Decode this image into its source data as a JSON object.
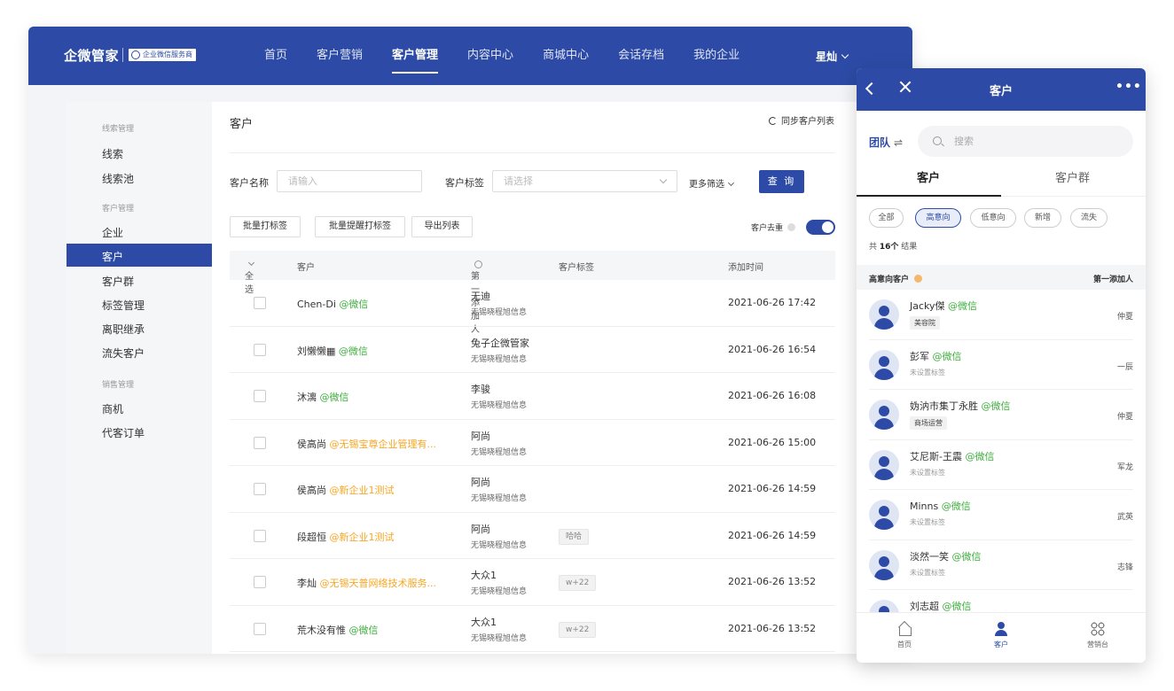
{
  "app": {
    "brand": "企微管家",
    "badge": "企业微信服务商"
  },
  "nav": [
    "首页",
    "客户营销",
    "客户管理",
    "内容中心",
    "商城中心",
    "会话存档",
    "我的企业"
  ],
  "nav_active": "客户管理",
  "user": {
    "name": "星灿"
  },
  "sidebar": {
    "groups": [
      {
        "title": "线索管理",
        "items": [
          "线索",
          "线索池"
        ]
      },
      {
        "title": "客户管理",
        "items": [
          "企业",
          "客户",
          "客户群",
          "标签管理",
          "离职继承",
          "流失客户"
        ]
      },
      {
        "title": "销售管理",
        "items": [
          "商机",
          "代客订单"
        ]
      }
    ],
    "active": "客户"
  },
  "main": {
    "title": "客户",
    "sync_label": "同步客户列表",
    "filters": {
      "name_label": "客户名称",
      "name_placeholder": "请输入",
      "tag_label": "客户标签",
      "tag_placeholder": "请选择",
      "more_label": "更多筛选",
      "query_label": "查 询"
    },
    "actions": [
      "批量打标签",
      "批量提醒打标签",
      "导出列表"
    ],
    "dedup_label": "客户去重",
    "dedup_on": true,
    "columns": {
      "select_all": "全选",
      "customer": "客户",
      "adder": "第一添加人",
      "tags": "客户标签",
      "time": "添加时间"
    },
    "rows": [
      {
        "name": "Chen-Di",
        "source": "@微信",
        "source_color": "#3fae3f",
        "adder": "无迪",
        "org": "无锡晓程旭信息",
        "tag": "",
        "time": "2021-06-26 17:42"
      },
      {
        "name": "刘懒懒▦",
        "source": "@微信",
        "source_color": "#3fae3f",
        "adder": "兔子企微管家",
        "org": "无锡晓程旭信息",
        "tag": "",
        "time": "2021-06-26 16:54"
      },
      {
        "name": "沐漓",
        "source": "@微信",
        "source_color": "#3fae3f",
        "adder": "李骏",
        "org": "无锡晓程旭信息",
        "tag": "",
        "time": "2021-06-26 16:08"
      },
      {
        "name": "侯高尚",
        "source": "@无锡宝尊企业管理有...",
        "source_color": "#f5a623",
        "adder": "阿尚",
        "org": "无锡晓程旭信息",
        "tag": "",
        "time": "2021-06-26 15:00"
      },
      {
        "name": "侯高尚",
        "source": "@新企业1测试",
        "source_color": "#f5a623",
        "adder": "阿尚",
        "org": "无锡晓程旭信息",
        "tag": "",
        "time": "2021-06-26 14:59"
      },
      {
        "name": "段超恒",
        "source": "@新企业1测试",
        "source_color": "#f5a623",
        "adder": "阿尚",
        "org": "无锡晓程旭信息",
        "tag": "哈哈",
        "time": "2021-06-26 14:59"
      },
      {
        "name": "李灿",
        "source": "@无锡天普网络技术服务...",
        "source_color": "#f5a623",
        "adder": "大众1",
        "org": "无锡晓程旭信息",
        "tag": "w+22",
        "time": "2021-06-26 13:52"
      },
      {
        "name": "荒木没有惟",
        "source": "@微信",
        "source_color": "#3fae3f",
        "adder": "大众1",
        "org": "无锡晓程旭信息",
        "tag": "w+22",
        "time": "2021-06-26 13:52"
      }
    ]
  },
  "mobile": {
    "title": "客户",
    "more": "•••",
    "team_label": "团队",
    "team_switch": "⇌",
    "search_placeholder": "搜索",
    "tabs": [
      "客户",
      "客户群"
    ],
    "chips": [
      "全部",
      "高意向",
      "低意向",
      "新增",
      "流失"
    ],
    "active_chip": "高意向",
    "count": {
      "prefix": "共",
      "number": "16个",
      "suffix": "结果"
    },
    "section": {
      "title": "高意向客户",
      "right": "第一添加人"
    },
    "customers": [
      {
        "name": "Jacky傑",
        "source": "@微信",
        "tag": "美容院",
        "sub": "",
        "owner": "仲夏"
      },
      {
        "name": "彭军",
        "source": "@微信",
        "tag": "",
        "sub": "未设置标签",
        "owner": "一辰"
      },
      {
        "name": "妫汭市集丁永胜",
        "source": "@微信",
        "tag": "商场运营",
        "sub": "",
        "owner": "仲夏"
      },
      {
        "name": "艾尼斯-王震",
        "source": "@微信",
        "tag": "",
        "sub": "未设置标签",
        "owner": "军龙"
      },
      {
        "name": "Minns",
        "source": "@微信",
        "tag": "",
        "sub": "未设置标签",
        "owner": "武英"
      },
      {
        "name": "淡然一笑",
        "source": "@微信",
        "tag": "",
        "sub": "未设置标签",
        "owner": "志锋"
      },
      {
        "name": "刘志超",
        "source": "@微信",
        "tag": "",
        "sub": "",
        "owner": ""
      }
    ],
    "footer": [
      "首页",
      "客户",
      "营销台"
    ],
    "footer_active": "客户"
  },
  "colors": {
    "primary": "#2d4ba6",
    "wechat": "#3fae3f",
    "corp": "#f5a623"
  }
}
